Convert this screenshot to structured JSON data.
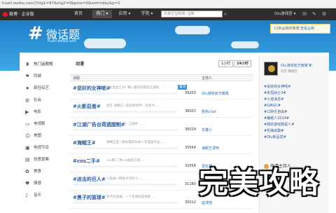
{
  "browser": {
    "url": "huati.weibo.com/?ctg1=97&ctg2=0&prov=0&sort=day&p=1"
  },
  "topnav": {
    "logo": "微博 · 企业版",
    "items": [
      "首页",
      "热门 ▾",
      "应用 ▾",
      "学院 ▾"
    ],
    "active_index": 1,
    "search_placeholder": "大家正在热搜: 汪峰",
    "user": "Olu游戏官 ▾"
  },
  "banner": {
    "title": "微话题",
    "url": "huati.weibo.com",
    "notice_prefix": "13条@我的微博,",
    "notice_link": "查看@我"
  },
  "sidebar": {
    "items": [
      {
        "icon": "trophy-icon",
        "label": "热门话题榜"
      },
      {
        "icon": "flag-icon",
        "label": "同城"
      },
      {
        "icon": "star-icon",
        "label": "疯狂综艺"
      },
      {
        "icon": "globe-icon",
        "label": "社会"
      },
      {
        "icon": "film-icon",
        "label": "电影"
      },
      {
        "icon": "tv-icon",
        "label": "电视剧"
      },
      {
        "icon": "person-icon",
        "label": "美图"
      },
      {
        "icon": "screen-icon",
        "label": "电视节目"
      },
      {
        "icon": "book-icon",
        "label": "创意提案"
      },
      {
        "icon": "food-icon",
        "label": "美食"
      },
      {
        "icon": "heart-icon",
        "label": "情感"
      },
      {
        "icon": "music-icon",
        "label": "音乐"
      }
    ]
  },
  "feed": {
    "title": "动漫",
    "toggle_hour": "1小时",
    "toggle_day": "24小时",
    "col_topic": "话题",
    "col_host": "主持人",
    "rows": [
      {
        "title": "#说好的女神呢#",
        "desc": "#永恒战士3# 晴心魂说的我是正美眼……",
        "count": "39203",
        "host": "Olu游戏官方微博",
        "tag": "置顶"
      },
      {
        "title": "#火影忍者#",
        "desc": "是在 海贼王一起的新世界一次关卡……",
        "count": "38003",
        "host": "剧热chat",
        "tag": ""
      },
      {
        "title": "#江湖广告台荷遗腊制#",
        "desc": "《江湖广告台》江湖中……",
        "count": "36019",
        "host": "龙雕小",
        "tag": ""
      },
      {
        "title": "#海贼王#",
        "desc": "海贼王是一部长篇的日本少年漫画作品……",
        "count": "35564",
        "host": "海贼王漫吧",
        "tag": ""
      },
      {
        "title": "#cos二手#",
        "desc": "cos网 二手cos服装交易……",
        "count": "32056",
        "host": "爱好君",
        "tag": ""
      },
      {
        "title": "#进击的巨人#",
        "desc": "人类被一群高大的巨人……",
        "count": "31180",
        "host": "进击吧",
        "tag": ""
      },
      {
        "title": "#黑子的篮球#",
        "desc": "黑子的篮球，一个普通的篮球部……",
        "count": "30012",
        "host": "篮球部",
        "tag": ""
      }
    ]
  },
  "right": {
    "host_name": "Olu游戏官方微博",
    "host_loc": "北京 朝阳区",
    "topics": [
      "#说好的女神呢#",
      "#永恒战士3#",
      "#小道消息#",
      "#GMGC#",
      "#口碎乐自由#",
      "#魔者人2014#",
      "#我的游戏我是人#",
      "#机械战警#",
      "#Olu新品发#"
    ],
    "apply_label": "申请主持人"
  },
  "watermark": "完美攻略",
  "colors": {
    "banner": "#2e8fd6",
    "nav": "#2e2e2e",
    "link": "#2a5a9e"
  }
}
